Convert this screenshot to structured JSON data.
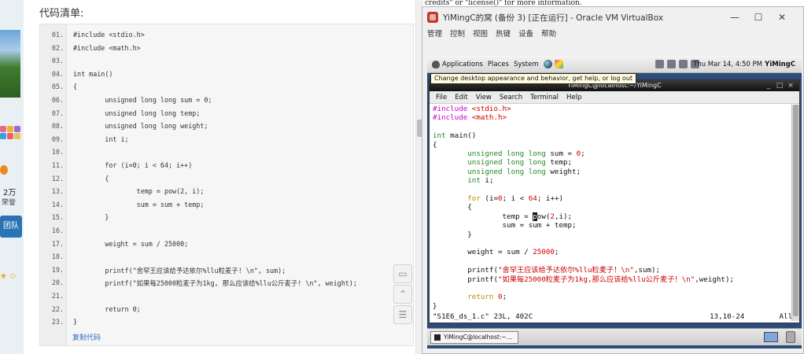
{
  "webpage": {
    "code_title": "代码清单:",
    "stat_count": "2万",
    "stat_label": "荣誉",
    "team_label": "团队",
    "copy_link": "复制代码",
    "code_lines": [
      {
        "no": "01.",
        "text": "#include <stdio.h>"
      },
      {
        "no": "02.",
        "text": "#include <math.h>"
      },
      {
        "no": "03.",
        "text": ""
      },
      {
        "no": "04.",
        "text": "int main()"
      },
      {
        "no": "05.",
        "text": "{"
      },
      {
        "no": "06.",
        "text": "        unsigned long long sum = 0;"
      },
      {
        "no": "07.",
        "text": "        unsigned long long temp;"
      },
      {
        "no": "08.",
        "text": "        unsigned long long weight;"
      },
      {
        "no": "09.",
        "text": "        int i;"
      },
      {
        "no": "10.",
        "text": ""
      },
      {
        "no": "11.",
        "text": "        for (i=0; i < 64; i++)"
      },
      {
        "no": "12.",
        "text": "        {"
      },
      {
        "no": "13.",
        "text": "                temp = pow(2, i);"
      },
      {
        "no": "14.",
        "text": "                sum = sum + temp;"
      },
      {
        "no": "15.",
        "text": "        }"
      },
      {
        "no": "16.",
        "text": ""
      },
      {
        "no": "17.",
        "text": "        weight = sum / 25000;"
      },
      {
        "no": "18.",
        "text": ""
      },
      {
        "no": "19.",
        "text": "        printf(\"舍罕王应该给予达依尔%llu粒麦子! \\n\", sum);"
      },
      {
        "no": "20.",
        "text": "        printf(\"如果每25000粒麦子为1kg, 那么应该给%llu公斤麦子! \\n\", weight);"
      },
      {
        "no": "21.",
        "text": ""
      },
      {
        "no": "22.",
        "text": "        return 0;"
      },
      {
        "no": "23.",
        "text": "}"
      }
    ],
    "tool_icons": [
      "comment-icon",
      "back-to-top-icon",
      "list-icon"
    ]
  },
  "background_terminal": {
    "text": "credits\" or \"license()\" for more information."
  },
  "vbox": {
    "title": "YiMingC的窝 (备份 3) [正在运行] - Oracle VM VirtualBox",
    "menu": [
      "管理",
      "控制",
      "视图",
      "热键",
      "设备",
      "帮助"
    ],
    "gnome_panel": {
      "applications": "Applications",
      "places": "Places",
      "system": "System",
      "clock": "Thu Mar 14,  4:50 PM",
      "user": "YiMingC",
      "tooltip": "Change desktop appearance and behavior, get help, or log out"
    },
    "terminal": {
      "title": "YiMingC@localhost:~/YiMingC",
      "menu": [
        "File",
        "Edit",
        "View",
        "Search",
        "Terminal",
        "Help"
      ],
      "status_left": "\"S1E6_ds_1.c\" 23L, 402C",
      "status_right": "13,10-24        All"
    },
    "taskbar_button": "YiMingC@localhost:~..."
  }
}
